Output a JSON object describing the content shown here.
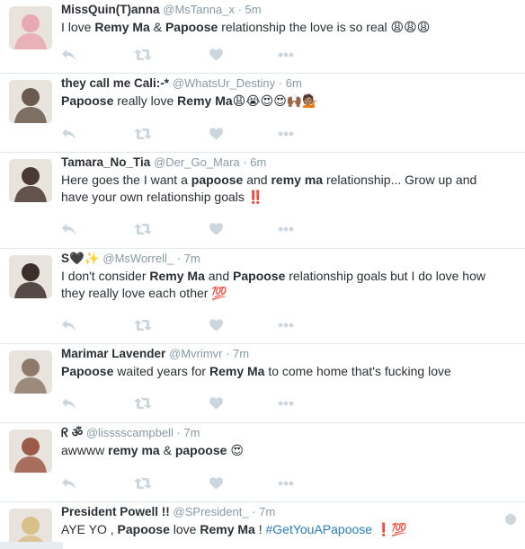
{
  "tweets": [
    {
      "name": "MissQuin(T)anna",
      "handle": "@MsTanna_x",
      "time": "5m",
      "segments": [
        {
          "t": "I love "
        },
        {
          "t": "Remy Ma",
          "b": true
        },
        {
          "t": " & "
        },
        {
          "t": "Papoose",
          "b": true
        },
        {
          "t": " relationship the love is so real "
        },
        {
          "t": "😩😩😩",
          "e": true
        }
      ],
      "avatar_color": "#e7a9b2"
    },
    {
      "name": "they call me Cali:-*",
      "handle": "@WhatsUr_Destiny",
      "time": "6m",
      "segments": [
        {
          "t": "Papoose",
          "b": true
        },
        {
          "t": " really love "
        },
        {
          "t": "Remy Ma",
          "b": true
        },
        {
          "t": "😩😭😍😍🙌🏾💁🏽",
          "e": true
        }
      ],
      "avatar_color": "#6b5a4e"
    },
    {
      "name": "Tamara_No_Tia",
      "handle": "@Der_Go_Mara",
      "time": "6m",
      "segments": [
        {
          "t": "Here goes the I want a "
        },
        {
          "t": "papoose",
          "b": true
        },
        {
          "t": " and "
        },
        {
          "t": "remy ma",
          "b": true
        },
        {
          "t": " relationship... Grow up and have your own relationship goals ‼️"
        }
      ],
      "avatar_color": "#4a3a33"
    },
    {
      "name": "S🖤✨",
      "handle": "@MsWorrell_",
      "time": "7m",
      "segments": [
        {
          "t": "I don't consider "
        },
        {
          "t": "Remy Ma",
          "b": true
        },
        {
          "t": " and "
        },
        {
          "t": "Papoose",
          "b": true
        },
        {
          "t": " relationship goals but I do love how they really love each other "
        },
        {
          "t": "💯",
          "e": true
        }
      ],
      "avatar_color": "#3b2f2a"
    },
    {
      "name": "Marimar Lavender",
      "handle": "@Mvrimvr",
      "time": "7m",
      "segments": [
        {
          "t": "Papoose",
          "b": true
        },
        {
          "t": " waited years for "
        },
        {
          "t": "Remy Ma",
          "b": true
        },
        {
          "t": " to come home that's fucking love"
        }
      ],
      "avatar_color": "#8e7a6b"
    },
    {
      "name": "ᖇ ॐ",
      "handle": "@lisssscampbell",
      "time": "7m",
      "segments": [
        {
          "t": "awwww "
        },
        {
          "t": "remy ma",
          "b": true
        },
        {
          "t": " & "
        },
        {
          "t": "papoose",
          "b": true
        },
        {
          "t": " "
        },
        {
          "t": "😍",
          "e": true
        }
      ],
      "avatar_color": "#9c5a48"
    },
    {
      "name": "President Powell !!",
      "handle": "@SPresident_",
      "time": "7m",
      "segments": [
        {
          "t": "AYE YO , "
        },
        {
          "t": "Papoose",
          "b": true
        },
        {
          "t": " love "
        },
        {
          "t": "Remy Ma",
          "b": true
        },
        {
          "t": " ! "
        },
        {
          "t": "#GetYouAPapoose",
          "h": true
        },
        {
          "t": " "
        },
        {
          "t": "❗💯",
          "e": true
        }
      ],
      "avatar_color": "#d8c08a"
    }
  ],
  "icons": {
    "reply": "reply-icon",
    "retweet": "retweet-icon",
    "like": "heart-icon",
    "more": "more-icon"
  },
  "colors": {
    "icon": "#ccd6dd",
    "meta": "#8899a6",
    "text": "#292f33",
    "hashtag": "#2b7bb9",
    "divider": "#e1e8ed"
  }
}
